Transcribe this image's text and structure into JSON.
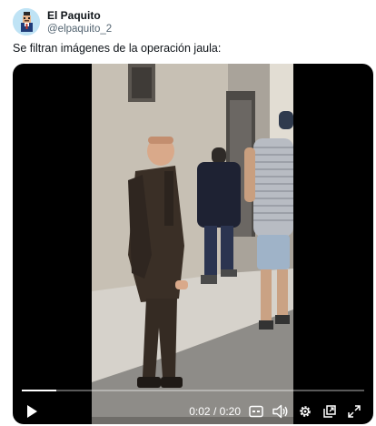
{
  "post": {
    "author_name": "El Paquito",
    "author_handle": "@elpaquito_2",
    "text": "Se filtran imágenes de la operación jaula:"
  },
  "video": {
    "current_time": "0:02",
    "separator": "/",
    "duration": "0:20",
    "progress_fraction": 0.1
  },
  "icons": {
    "avatar": "avatar-icon",
    "play": "play-icon",
    "captions": "captions-icon",
    "volume": "volume-icon",
    "settings": "gear-icon",
    "popout": "popout-icon",
    "fullscreen": "fullscreen-icon"
  },
  "colors": {
    "text_primary": "#0f1419",
    "text_secondary": "#536471",
    "media_background": "#000000"
  }
}
